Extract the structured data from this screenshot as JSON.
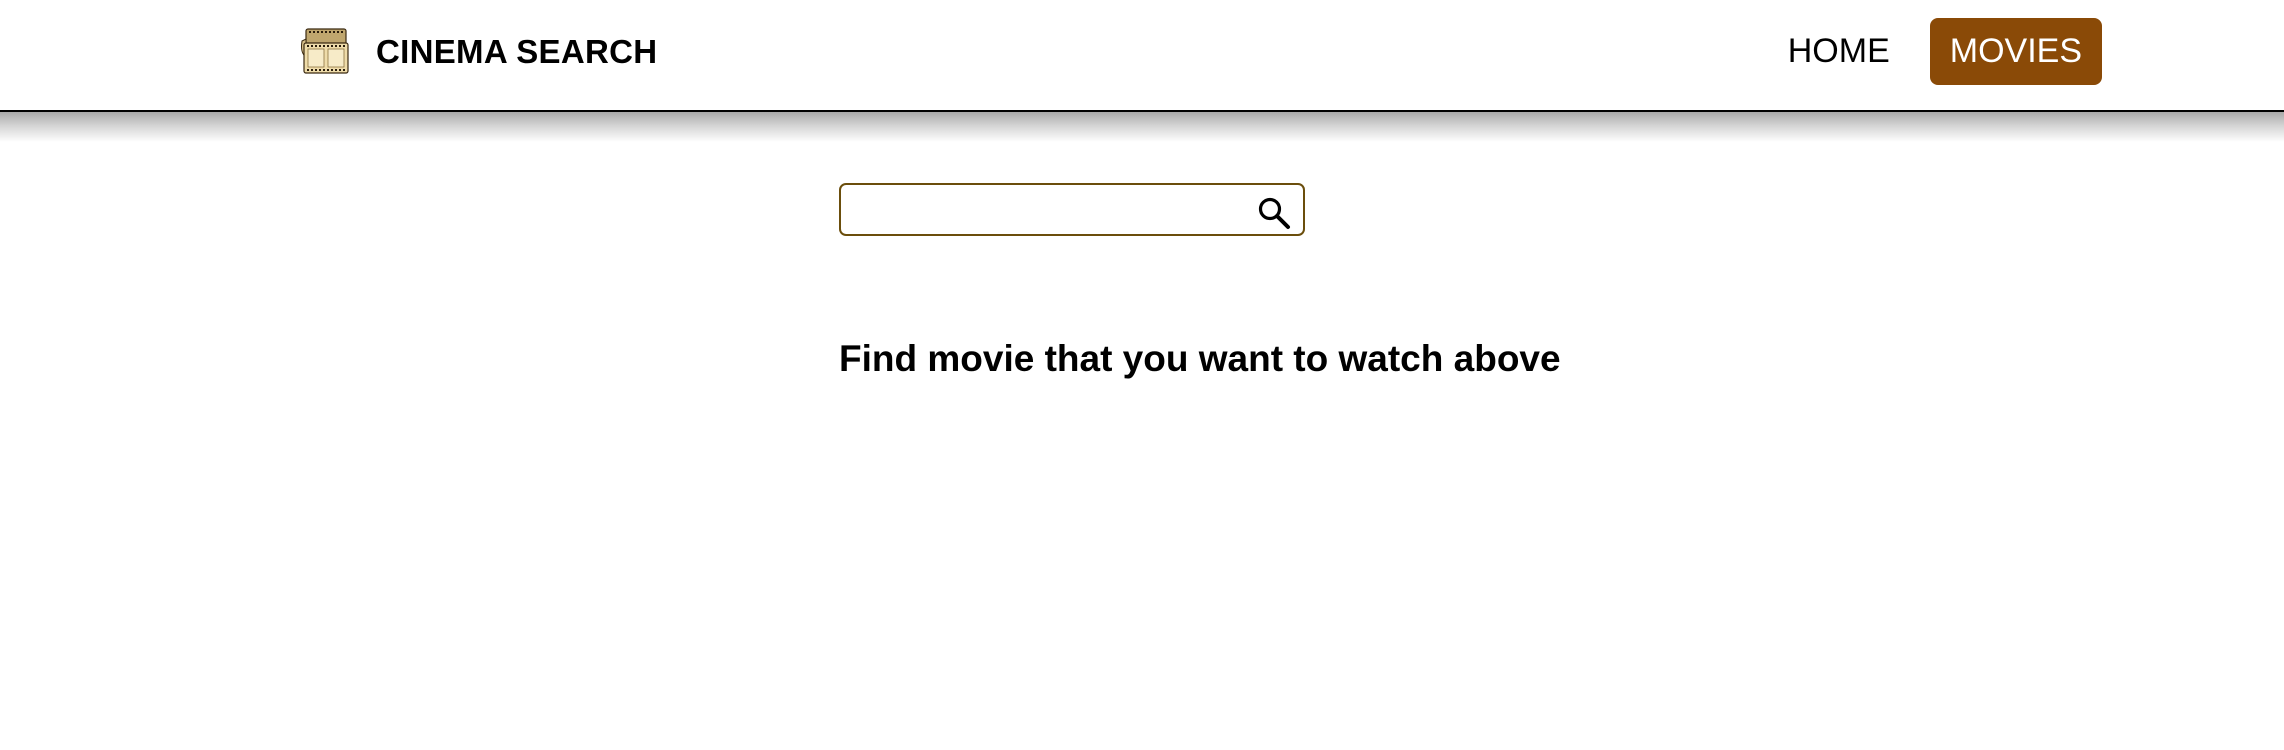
{
  "header": {
    "brand_title": "CINEMA SEARCH",
    "logo_icon": "film-reel-icon",
    "nav": [
      {
        "label": "HOME",
        "active": false
      },
      {
        "label": "MOVIES",
        "active": true
      }
    ]
  },
  "search": {
    "value": "",
    "placeholder": "",
    "icon": "search-icon"
  },
  "main": {
    "hint": "Find movie that you want to watch above"
  },
  "colors": {
    "accent": "#8a4a07",
    "search_border": "#6b4e0c"
  }
}
